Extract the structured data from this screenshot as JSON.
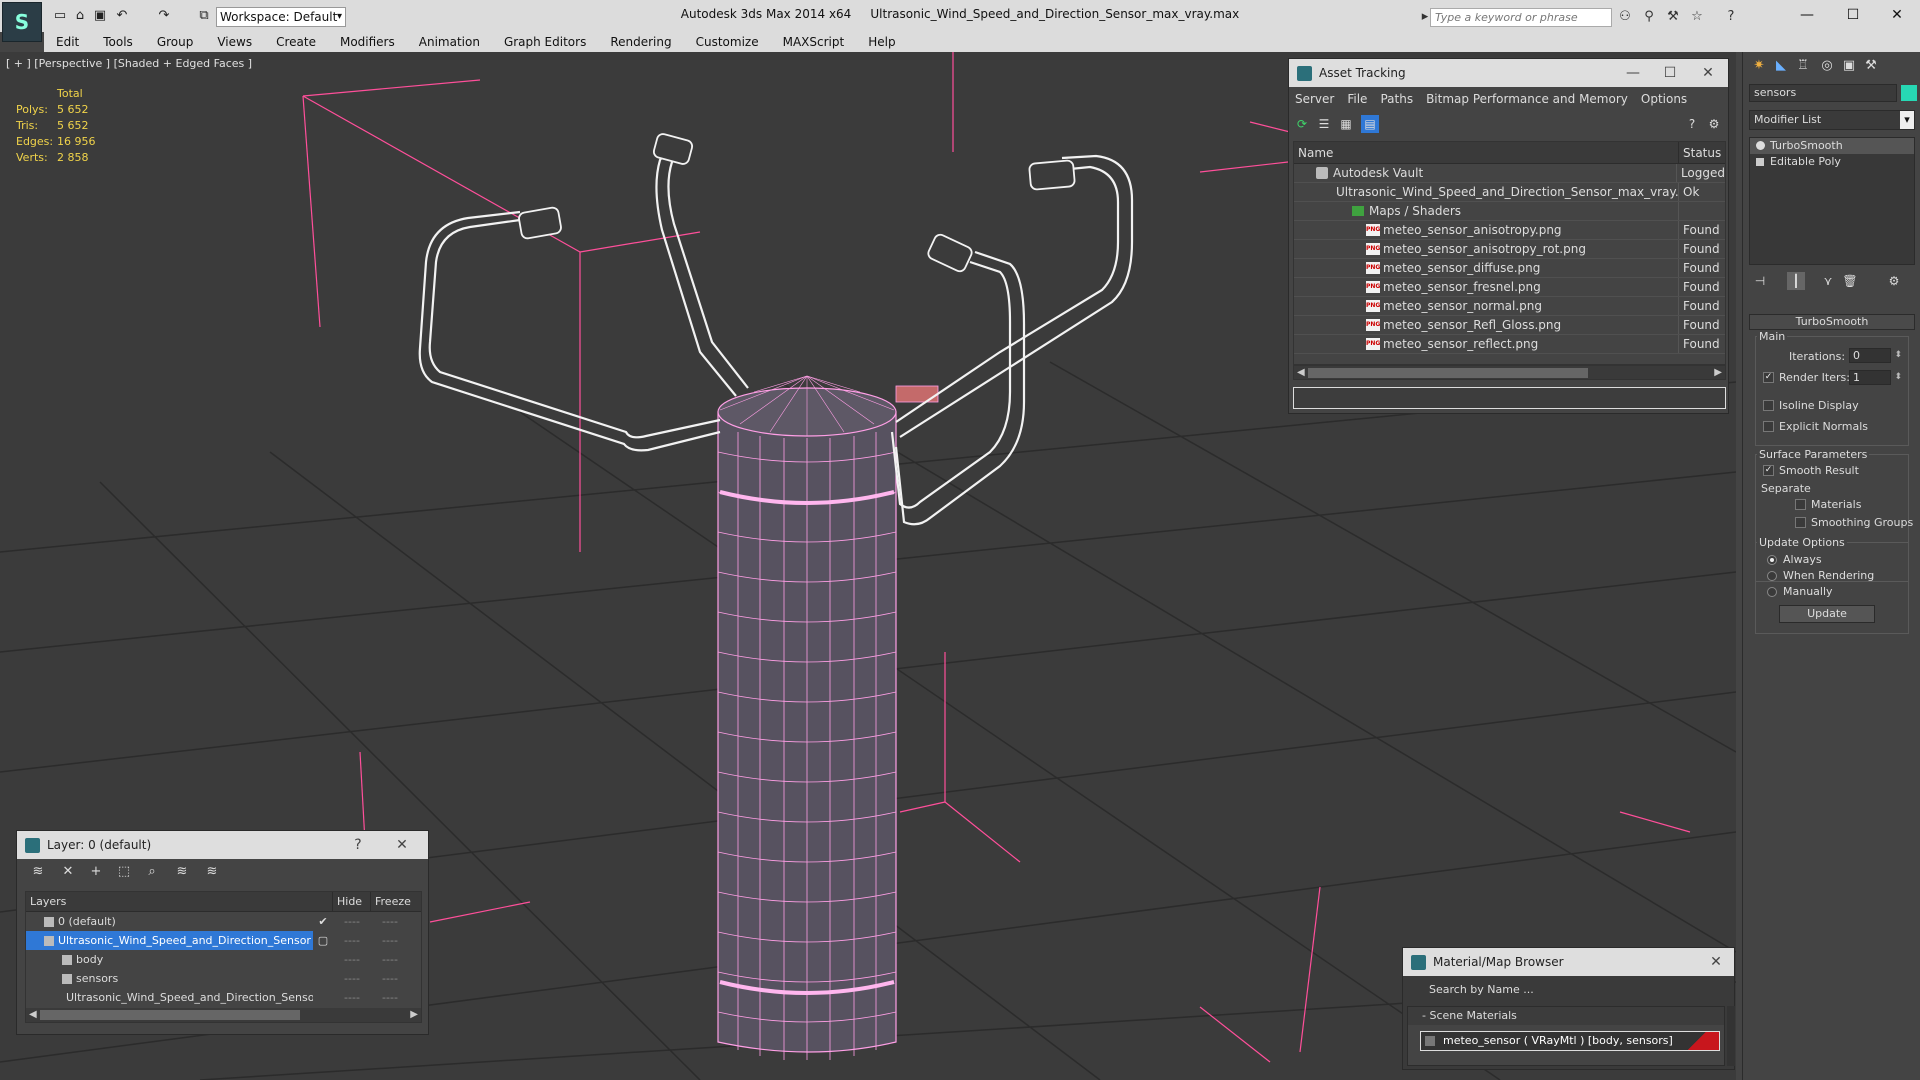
{
  "titlebar": {
    "workspace": "Workspace: Default",
    "app_title": "Autodesk 3ds Max  2014 x64",
    "file_name": "Ultrasonic_Wind_Speed_and_Direction_Sensor_max_vray.max",
    "search_placeholder": "Type a keyword or phrase"
  },
  "menu": [
    "Edit",
    "Tools",
    "Group",
    "Views",
    "Create",
    "Modifiers",
    "Animation",
    "Graph Editors",
    "Rendering",
    "Customize",
    "MAXScript",
    "Help"
  ],
  "viewport": {
    "label": "[ + ] [Perspective ] [Shaded + Edged Faces ]",
    "stats": {
      "header": "Total",
      "rows": [
        {
          "k": "Polys:",
          "v": "5 652"
        },
        {
          "k": "Tris:",
          "v": "5 652"
        },
        {
          "k": "Edges:",
          "v": "16 956"
        },
        {
          "k": "Verts:",
          "v": "2 858"
        }
      ]
    },
    "colors": {
      "wire": "#ff9fe6",
      "white_wire": "#f2f2f2",
      "grid": "#2a2a2a",
      "bounds": "#ff4f9a"
    }
  },
  "asset_tracking": {
    "title": "Asset Tracking",
    "menu": [
      "Server",
      "File",
      "Paths",
      "Bitmap Performance and Memory",
      "Options"
    ],
    "columns": {
      "name": "Name",
      "status": "Status"
    },
    "rows": [
      {
        "name": "Autodesk Vault",
        "status": "Logged",
        "icon": "vault-icon"
      },
      {
        "name": "Ultrasonic_Wind_Speed_and_Direction_Sensor_max_vray.max",
        "status": "Ok",
        "icon": "max-file-icon"
      },
      {
        "name": "Maps / Shaders",
        "status": "",
        "icon": "folder-icon"
      },
      {
        "name": "meteo_sensor_anisotropy.png",
        "status": "Found",
        "icon": "png-icon"
      },
      {
        "name": "meteo_sensor_anisotropy_rot.png",
        "status": "Found",
        "icon": "png-icon"
      },
      {
        "name": "meteo_sensor_diffuse.png",
        "status": "Found",
        "icon": "png-icon"
      },
      {
        "name": "meteo_sensor_fresnel.png",
        "status": "Found",
        "icon": "png-icon"
      },
      {
        "name": "meteo_sensor_normal.png",
        "status": "Found",
        "icon": "png-icon"
      },
      {
        "name": "meteo_sensor_Refl_Gloss.png",
        "status": "Found",
        "icon": "png-icon"
      },
      {
        "name": "meteo_sensor_reflect.png",
        "status": "Found",
        "icon": "png-icon"
      }
    ]
  },
  "command_panel": {
    "object_name": "sensors",
    "object_color": "#27d8b4",
    "modifier_list": "Modifier List",
    "stack": [
      "TurboSmooth",
      "Editable Poly"
    ],
    "rollout": "TurboSmooth",
    "main_label": "Main",
    "iterations_label": "Iterations:",
    "iterations_value": "0",
    "render_iters_label": "Render Iters:",
    "render_iters_value": "1",
    "isoline_label": "Isoline Display",
    "explicit_normals_label": "Explicit Normals",
    "surface_params_label": "Surface Parameters",
    "smooth_result_label": "Smooth Result",
    "separate_label": "Separate",
    "materials_label": "Materials",
    "smoothing_groups_label": "Smoothing Groups",
    "update_options_label": "Update Options",
    "always_label": "Always",
    "when_rendering_label": "When Rendering",
    "manually_label": "Manually",
    "update_button": "Update"
  },
  "layer_window": {
    "title": "Layer: 0 (default)",
    "columns": {
      "layers": "Layers",
      "hide": "Hide",
      "freeze": "Freeze"
    },
    "rows": [
      {
        "name": "0 (default)",
        "indent": 1,
        "mark": "✔"
      },
      {
        "name": "Ultrasonic_Wind_Speed_and_Direction_Sensor",
        "indent": 1,
        "mark": "▢"
      },
      {
        "name": "body",
        "indent": 2,
        "mark": ""
      },
      {
        "name": "sensors",
        "indent": 2,
        "mark": ""
      },
      {
        "name": "Ultrasonic_Wind_Speed_and_Direction_Sensor",
        "indent": 2,
        "mark": ""
      }
    ],
    "dash": "----"
  },
  "material_browser": {
    "title": "Material/Map Browser",
    "search_placeholder": "Search by Name ...",
    "section": "- Scene Materials",
    "entry": "meteo_sensor  ( VRayMtl ) [body, sensors]"
  }
}
